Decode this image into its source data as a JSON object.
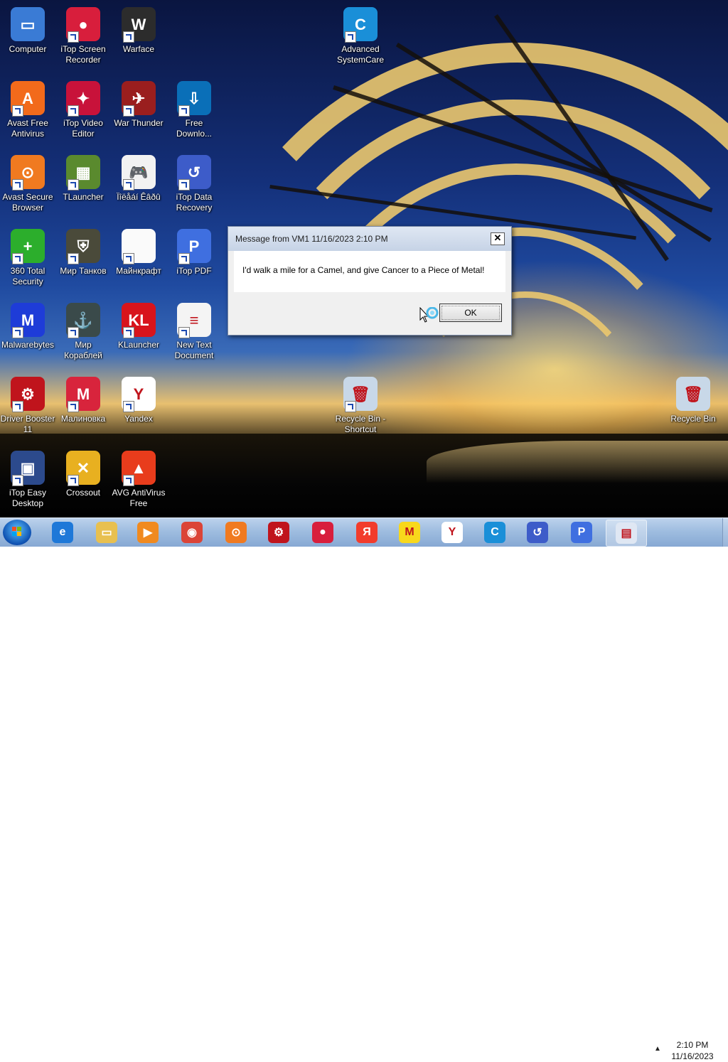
{
  "desktop_icons": [
    {
      "label": "Computer",
      "color": "#3a7bd5",
      "glyph": "▭",
      "name": "computer-icon"
    },
    {
      "label": "iTop Screen Recorder",
      "color": "#d81e3c",
      "glyph": "●",
      "name": "itop-screen-recorder-icon"
    },
    {
      "label": "Warface",
      "color": "#2c2c2c",
      "glyph": "W",
      "name": "warface-icon"
    },
    {
      "label": "Advanced SystemCare",
      "color": "#1a8fd8",
      "glyph": "C",
      "name": "advanced-systemcare-icon"
    },
    {
      "label": "Avast Free Antivirus",
      "color": "#f26a1b",
      "glyph": "A",
      "name": "avast-antivirus-icon"
    },
    {
      "label": "iTop Video Editor",
      "color": "#c8123a",
      "glyph": "✦",
      "name": "itop-video-editor-icon"
    },
    {
      "label": "War Thunder",
      "color": "#9a1e1e",
      "glyph": "✈",
      "name": "war-thunder-icon"
    },
    {
      "label": "Free Downlo...",
      "color": "#0a6fb8",
      "glyph": "⇩",
      "name": "free-download-icon"
    },
    {
      "label": "Avast Secure Browser",
      "color": "#f07a20",
      "glyph": "⊙",
      "name": "avast-browser-icon"
    },
    {
      "label": "TLauncher",
      "color": "#5a8a2e",
      "glyph": "▦",
      "name": "tlauncher-icon"
    },
    {
      "label": "Ïîëåáí Êâðû",
      "color": "#f2f2f2",
      "glyph": "🎮",
      "name": "game-controller-icon"
    },
    {
      "label": "iTop Data Recovery",
      "color": "#3d5cc9",
      "glyph": "↺",
      "name": "itop-data-recovery-icon"
    },
    {
      "label": "360 Total Security",
      "color": "#2cae2c",
      "glyph": "+",
      "name": "360-total-security-icon"
    },
    {
      "label": "Мир Танков",
      "color": "#4a4a3a",
      "glyph": "⛨",
      "name": "mir-tankov-icon"
    },
    {
      "label": "Майнкрафт",
      "color": "#fafafa",
      "glyph": "",
      "name": "minecraft-file-icon"
    },
    {
      "label": "iTop PDF",
      "color": "#3f6fe0",
      "glyph": "P",
      "name": "itop-pdf-icon"
    },
    {
      "label": "Malwarebytes",
      "color": "#1e3cd8",
      "glyph": "M",
      "name": "malwarebytes-icon"
    },
    {
      "label": "Мир Кораблей",
      "color": "#3a4a4a",
      "glyph": "⚓",
      "name": "mir-korabley-icon"
    },
    {
      "label": "KLauncher",
      "color": "#d8141c",
      "glyph": "KL",
      "name": "klauncher-icon"
    },
    {
      "label": "New Text Document",
      "color": "#f4f4f4",
      "glyph": "≡",
      "name": "text-document-icon"
    },
    {
      "label": "Driver Booster 11",
      "color": "#c0141c",
      "glyph": "⚙",
      "name": "driver-booster-icon"
    },
    {
      "label": "Малиновка",
      "color": "#d8243c",
      "glyph": "M",
      "name": "malinovka-icon"
    },
    {
      "label": "Yandex",
      "color": "#ffffff",
      "glyph": "Y",
      "name": "yandex-icon"
    },
    {
      "label": "Recycle Bin - Shortcut",
      "color": "#c8d8e8",
      "glyph": "🗑",
      "name": "recycle-bin-shortcut-icon"
    },
    {
      "label": "Recycle Bin",
      "color": "#c8d8e8",
      "glyph": "🗑",
      "name": "recycle-bin-icon"
    },
    {
      "label": "iTop Easy Desktop",
      "color": "#2c4a8c",
      "glyph": "▣",
      "name": "itop-easy-desktop-icon"
    },
    {
      "label": "Crossout",
      "color": "#e8b020",
      "glyph": "✕",
      "name": "crossout-icon"
    },
    {
      "label": "AVG AntiVirus Free",
      "color": "#e83c1c",
      "glyph": "▲",
      "name": "avg-antivirus-icon"
    }
  ],
  "dialog": {
    "title": "Message from VM1 11/16/2023 2:10 PM",
    "close_label": "✕",
    "message": "I'd walk a mile for a Camel, and give Cancer to a Piece of Metal!",
    "ok_label": "OK"
  },
  "taskbar": {
    "pinned": [
      {
        "name": "internet-explorer-icon",
        "color": "#1e78d8",
        "glyph": "e"
      },
      {
        "name": "file-explorer-icon",
        "color": "#e8c050",
        "glyph": "▭"
      },
      {
        "name": "media-player-icon",
        "color": "#f08a20",
        "glyph": "▶"
      },
      {
        "name": "chrome-icon",
        "color": "#db4437",
        "glyph": "◉"
      },
      {
        "name": "avast-browser-taskbar-icon",
        "color": "#f07a20",
        "glyph": "⊙"
      },
      {
        "name": "driver-booster-taskbar-icon",
        "color": "#c0141c",
        "glyph": "⚙"
      },
      {
        "name": "itop-screen-recorder-taskbar-icon",
        "color": "#d81e3c",
        "glyph": "●"
      },
      {
        "name": "yandex-browser-icon",
        "color": "#f23c2c",
        "glyph": "Я"
      },
      {
        "name": "yandex-market-icon",
        "color": "#f8d81c",
        "glyph": "M"
      },
      {
        "name": "yandex-taskbar-icon",
        "color": "#ffffff",
        "glyph": "Y"
      },
      {
        "name": "advanced-systemcare-taskbar-icon",
        "color": "#1a8fd8",
        "glyph": "C"
      },
      {
        "name": "itop-data-recovery-taskbar-icon",
        "color": "#3d5cc9",
        "glyph": "↺"
      },
      {
        "name": "itop-pdf-taskbar-icon",
        "color": "#3f6fe0",
        "glyph": "P"
      },
      {
        "name": "message-window-taskbar-icon",
        "color": "#dfe7f3",
        "glyph": "▤"
      }
    ],
    "tray_arrow": "▲",
    "time": "2:10 PM",
    "date": "11/16/2023"
  }
}
